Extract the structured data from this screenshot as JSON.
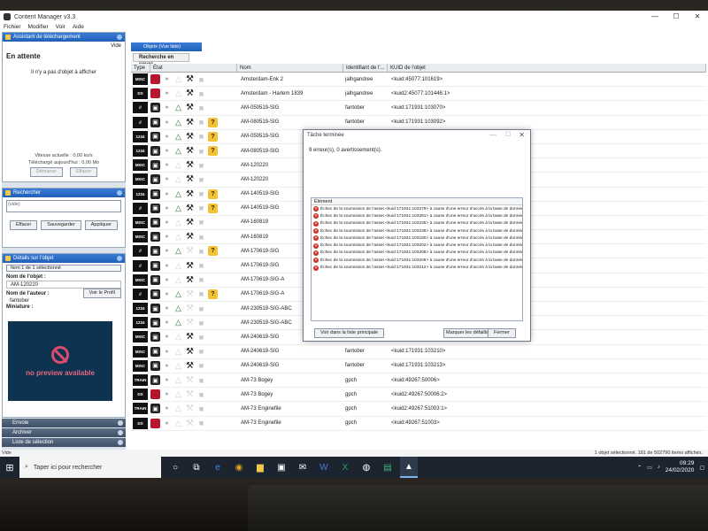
{
  "window": {
    "title": "Content Manager v3.3"
  },
  "menu": [
    "Fichier",
    "Modifier",
    "Voir",
    "Aide"
  ],
  "download_panel": {
    "title": "Assistant de téléchargement",
    "sub_right": "Vide",
    "status": "En attente",
    "empty_message": "Il n'y a pas d'objet à afficher",
    "speed": "Vitesse actuelle : 0,00 ko/s",
    "downloaded_today": "Téléchargé aujourd'hui : 0,00 Mo",
    "btn_start": "Démarrer",
    "btn_clear": "Effacer"
  },
  "search_panel": {
    "title": "Rechercher",
    "input_value": "(vide)",
    "btn_clear": "Effacer",
    "btn_save": "Sauvegarder",
    "btn_apply": "Appliquer"
  },
  "details_panel": {
    "title": "Détails sur l'objet",
    "selection": "Item 1 de 1 sélectionné",
    "name_label": "Nom de l'objet :",
    "name_value": "AM-120220",
    "author_label": "Nom de l'auteur :",
    "author_value": "fantober",
    "btn_profile": "Voir le Profil",
    "thumb_label": "Miniature :",
    "preview_text": "no preview available"
  },
  "collapsed_panels": [
    "Envoie",
    "Archiver",
    "Liste de sélection"
  ],
  "main": {
    "tab": "Objets (Vue liste)",
    "subtab": "Recherche en cours",
    "columns": [
      "Type",
      "État",
      "Nom",
      "Identifiant de l'...",
      "KUID de l'objet"
    ]
  },
  "rows": [
    {
      "type": "MISC",
      "state": [
        "red-doc",
        "dot",
        "tri-faint",
        "tool",
        "sq",
        "blank"
      ],
      "name": "Amsterdam-Enk 2",
      "author": "jalhgandree",
      "kuid": "<kuid:45077:101619>"
    },
    {
      "type": "DS",
      "state": [
        "red-doc",
        "dot",
        "tri-faint",
        "tool",
        "sq",
        "blank"
      ],
      "name": "Amsterdam - Harlem 1839",
      "author": "jalhgandree",
      "kuid": "<kuid2:45077:101446:1>"
    },
    {
      "type": "//",
      "state": [
        "lock",
        "dot",
        "tri",
        "tool",
        "sq",
        "blank"
      ],
      "name": "AM-050519-SIG",
      "author": "fantober",
      "kuid": "<kuid:171931:103070>"
    },
    {
      "type": "//",
      "state": [
        "lock",
        "dot",
        "tri",
        "tool",
        "sq",
        "warn"
      ],
      "name": "AM-080519-SIG",
      "author": "fantober",
      "kuid": "<kuid:171931:103092>"
    },
    {
      "type": "1234",
      "state": [
        "lock",
        "dot",
        "tri",
        "tool",
        "sq",
        "warn"
      ],
      "name": "AM-050519-SIG",
      "author": "",
      "kuid": ""
    },
    {
      "type": "1234",
      "state": [
        "lock",
        "dot",
        "tri",
        "tool",
        "sq",
        "warn"
      ],
      "name": "AM-080519-SIG",
      "author": "",
      "kuid": ""
    },
    {
      "type": "MISC",
      "state": [
        "lock",
        "dot",
        "tri-faint",
        "tool",
        "sq",
        "blank"
      ],
      "name": "AM-120220",
      "author": "",
      "kuid": ""
    },
    {
      "type": "MISC",
      "state": [
        "lock",
        "dot",
        "tri-faint",
        "tool",
        "sq",
        "blank"
      ],
      "name": "AM-120220",
      "author": "",
      "kuid": ""
    },
    {
      "type": "1234",
      "state": [
        "lock",
        "dot",
        "tri",
        "tool",
        "sq",
        "warn"
      ],
      "name": "AM-140519-SIG",
      "author": "",
      "kuid": ""
    },
    {
      "type": "//",
      "state": [
        "lock",
        "dot",
        "tri",
        "tool",
        "sq",
        "warn"
      ],
      "name": "AM-140519-SIG",
      "author": "",
      "kuid": ""
    },
    {
      "type": "MISC",
      "state": [
        "lock",
        "dot",
        "tri-faint",
        "tool",
        "sq",
        "blank"
      ],
      "name": "AM-160819",
      "author": "",
      "kuid": ""
    },
    {
      "type": "MISC",
      "state": [
        "lock",
        "dot",
        "tri-faint",
        "tool",
        "sq",
        "blank"
      ],
      "name": "AM-160819",
      "author": "",
      "kuid": ""
    },
    {
      "type": "//",
      "state": [
        "lock",
        "dot",
        "tri",
        "tool-faint",
        "sq",
        "warn"
      ],
      "name": "AM-170619-SIG",
      "author": "",
      "kuid": ""
    },
    {
      "type": "//",
      "state": [
        "lock",
        "dot",
        "tri-faint",
        "tool",
        "sq",
        "blank"
      ],
      "name": "AM-170619-SIG",
      "author": "",
      "kuid": ""
    },
    {
      "type": "MISC",
      "state": [
        "lock",
        "dot",
        "tri-faint",
        "tool",
        "sq",
        "blank"
      ],
      "name": "AM-170619-SIG-A",
      "author": "",
      "kuid": ""
    },
    {
      "type": "//",
      "state": [
        "lock",
        "dot",
        "tri",
        "tool-faint",
        "sq",
        "warn"
      ],
      "name": "AM-170619-SIG-A",
      "author": "",
      "kuid": ""
    },
    {
      "type": "1234",
      "state": [
        "lock",
        "dot",
        "tri",
        "tool-faint",
        "sq",
        "blank"
      ],
      "name": "AM-230519-SIG-ABC",
      "author": "",
      "kuid": ""
    },
    {
      "type": "1234",
      "state": [
        "lock",
        "dot",
        "tri",
        "tool-faint",
        "sq",
        "blank"
      ],
      "name": "AM-230519-SIG-ABC",
      "author": "",
      "kuid": ""
    },
    {
      "type": "MISC",
      "state": [
        "lock",
        "dot",
        "tri-faint",
        "tool",
        "sq",
        "blank"
      ],
      "name": "AM-240619-SIG",
      "author": "fantober",
      "kuid": "<kuid:171931:103209>"
    },
    {
      "type": "MISC",
      "state": [
        "lock",
        "dot",
        "tri-faint",
        "tool",
        "sq",
        "blank"
      ],
      "name": "AM-240619-SIG",
      "author": "fantober",
      "kuid": "<kuid:171931:103210>"
    },
    {
      "type": "MISC",
      "state": [
        "lock",
        "dot",
        "tri-faint",
        "tool",
        "sq",
        "blank"
      ],
      "name": "AM-240619-SIG",
      "author": "fantober",
      "kuid": "<kuid:171931:103213>"
    },
    {
      "type": "TRAIN",
      "state": [
        "lock",
        "dot",
        "tri-faint",
        "tool-faint",
        "sq",
        "blank"
      ],
      "name": "AM-73 Bogey",
      "author": "gpch",
      "kuid": "<kuid:49267:50006>"
    },
    {
      "type": "DS",
      "state": [
        "red-doc",
        "dot",
        "tri-faint",
        "tool-faint",
        "sq",
        "blank"
      ],
      "name": "AM-73 Bogey",
      "author": "gpch",
      "kuid": "<kuid2:49267:50006:2>"
    },
    {
      "type": "TRAIN",
      "state": [
        "lock",
        "dot",
        "tri-faint",
        "tool-faint",
        "sq",
        "blank"
      ],
      "name": "AM-73 Enginefile",
      "author": "gpch",
      "kuid": "<kuid2:49267:51003:1>"
    },
    {
      "type": "DS",
      "state": [
        "red-doc",
        "dot",
        "tri-faint",
        "tool-faint",
        "sq",
        "blank"
      ],
      "name": "AM-73 Enginefile",
      "author": "gpch",
      "kuid": "<kuid:49267:51003>"
    }
  ],
  "dialog": {
    "title": "Tâche terminée",
    "summary": "9 erreur(s), 0 avertissement(s).",
    "list_header": "Élément",
    "errors": [
      "Échec de la soumission de l'asset <kuid:171931:103279> à cause d'une erreur d'accès à la base de données",
      "Échec de la soumission de l'asset <kuid:171931:103281> à cause d'une erreur d'accès à la base de données",
      "Échec de la soumission de l'asset <kuid:171931:103235> à cause d'une erreur d'accès à la base de données",
      "Échec de la soumission de l'asset <kuid:171931:103238> à cause d'une erreur d'accès à la base de données",
      "Échec de la soumission de l'asset <kuid:171931:103180> à cause d'une erreur d'accès à la base de données",
      "Échec de la soumission de l'asset <kuid:171931:103202> à cause d'une erreur d'accès à la base de données",
      "Échec de la soumission de l'asset <kuid:171931:103208> à cause d'une erreur d'accès à la base de données",
      "Échec de la soumission de l'asset <kuid:171931:103206> à cause d'une erreur d'accès à la base de données",
      "Échec de la soumission de l'asset <kuid:171931:103212> à cause d'une erreur d'accès à la base de données"
    ],
    "btn_view_list": "Voir dans la liste principale",
    "btn_mark": "Marquer les défaillants",
    "btn_close": "Fermer"
  },
  "statusbar": {
    "left": "Vide",
    "right": "1 objet sélectionné. 181 de 502790 items affichés."
  },
  "taskbar": {
    "search_placeholder": "Taper ici pour rechercher",
    "time": "09:29",
    "date": "24/02/2020"
  },
  "colors": {
    "accent": "#2060b8",
    "error": "#d02b2b",
    "ok": "#1f7a2e",
    "warn": "#f1c232"
  }
}
